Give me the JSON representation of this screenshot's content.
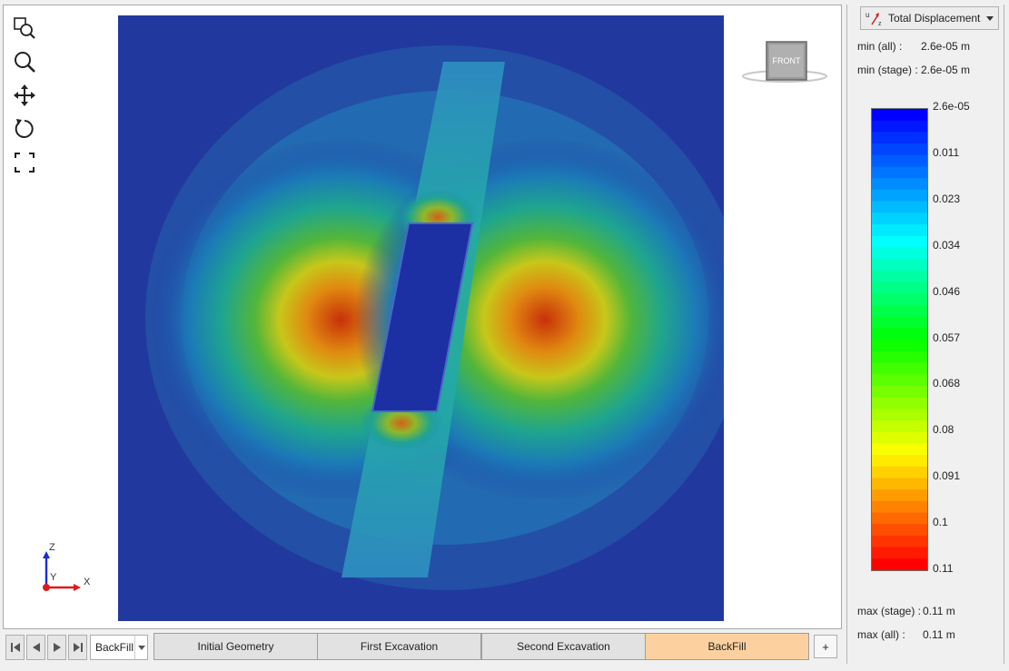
{
  "toolbar": {
    "tools": [
      {
        "name": "zoom-window-icon"
      },
      {
        "name": "zoom-icon"
      },
      {
        "name": "pan-icon"
      },
      {
        "name": "rotate-icon"
      },
      {
        "name": "fit-view-icon"
      }
    ]
  },
  "viewcube": {
    "label": "FRONT"
  },
  "axes": {
    "z": "Z",
    "y": "Y",
    "x": "X"
  },
  "stage_nav": {
    "selected": "BackFill",
    "tabs": [
      {
        "label": "Initial Geometry",
        "active": false
      },
      {
        "label": "First Excavation",
        "active": false
      },
      {
        "label": "Second Excavation",
        "active": false
      },
      {
        "label": "BackFill",
        "active": true
      }
    ],
    "add_label": "+"
  },
  "result_panel": {
    "result_type": "Total Displacement",
    "result_icon": "displacement-icon",
    "min_all_label": "min (all) :",
    "min_all_value": "2.6e-05 m",
    "min_stage_label": "min (stage) :",
    "min_stage_value": "2.6e-05 m",
    "max_stage_label": "max (stage) :",
    "max_stage_value": "0.11 m",
    "max_all_label": "max (all) :",
    "max_all_value": "0.11 m",
    "legend_ticks": [
      "2.6e-05",
      "0.011",
      "0.023",
      "0.034",
      "0.046",
      "0.057",
      "0.068",
      "0.08",
      "0.091",
      "0.1",
      "0.11"
    ]
  },
  "colors": {
    "low": "#0000ff",
    "mid": "#00ff00",
    "high": "#ff0000",
    "active_tab": "#fcd19f"
  }
}
